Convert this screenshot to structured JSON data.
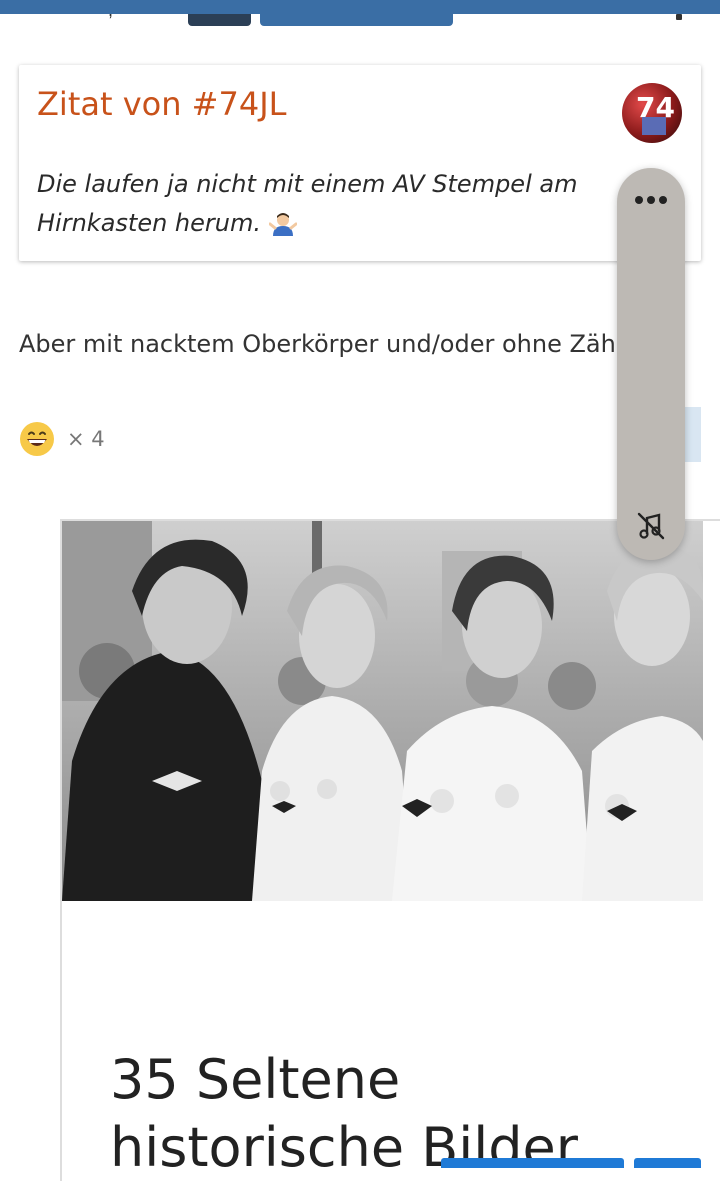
{
  "header": {
    "fragment_text": ","
  },
  "quote": {
    "author": "Zitat von #74JL",
    "avatar_text": "74",
    "text": "Die laufen ja nicht mit einem AV Stempel am Hirnkasten herum.",
    "emoji_icon": "person-shrugging-icon"
  },
  "post": {
    "text": "Aber mit nacktem Oberkörper und/oder ohne Zähne."
  },
  "reaction": {
    "icon": "grinning-face-icon",
    "count": "× 4"
  },
  "link_preview": {
    "title": "35 Seltene historische Bilder"
  },
  "floating_controls": {
    "more_icon": "more-horizontal-icon",
    "music_off_icon": "music-off-icon"
  },
  "colors": {
    "topbar": "#3a6ea5",
    "quote_author": "#c8521a",
    "button_blue": "#1f7ad6"
  }
}
